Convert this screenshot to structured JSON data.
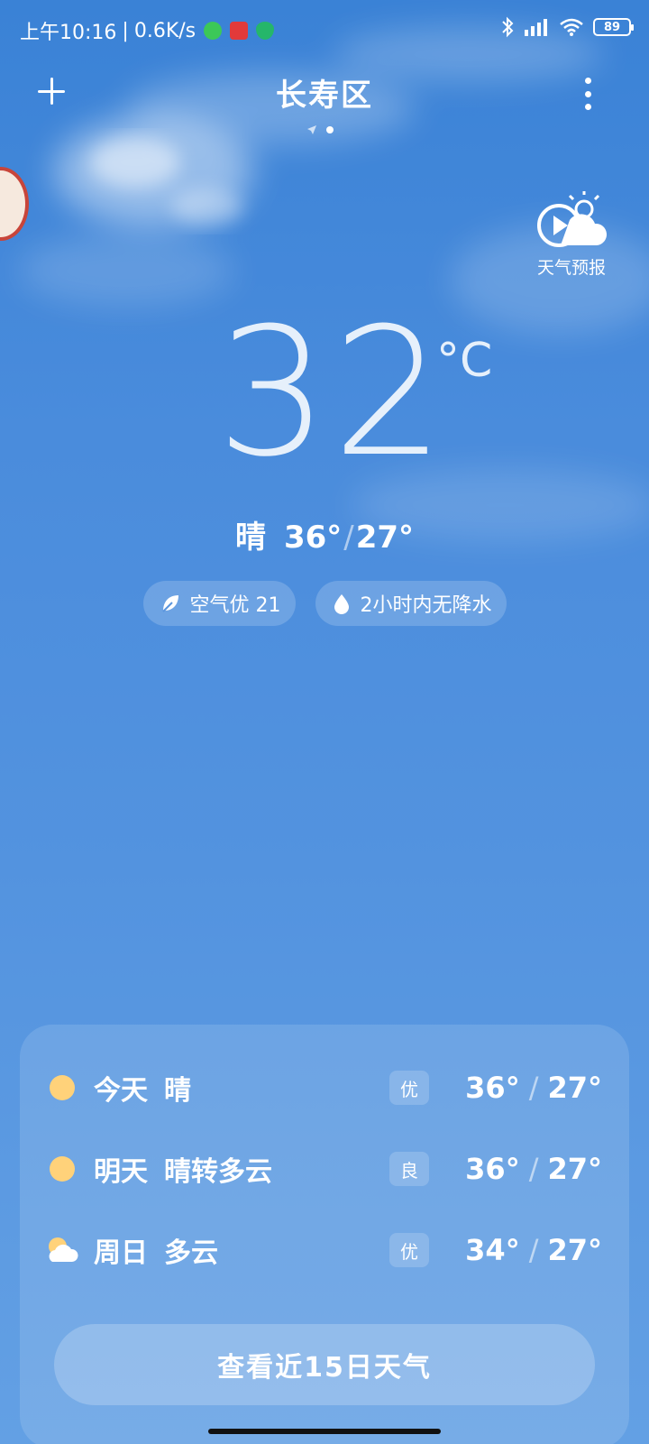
{
  "status_bar": {
    "time": "上午10:16",
    "net_speed": "0.6K/s",
    "battery": "89"
  },
  "header": {
    "city": "长寿区",
    "forecast_video_label": "天气预报"
  },
  "current": {
    "temperature": "32",
    "unit": "°C",
    "condition": "晴",
    "high": "36°",
    "low": "27°"
  },
  "chips": {
    "air_quality": "空气优 21",
    "precipitation": "2小时内无降水"
  },
  "forecast": [
    {
      "day": "今天",
      "weather": "晴",
      "aqi": "优",
      "high": "36°",
      "low": "27°",
      "icon": "sun-icon"
    },
    {
      "day": "明天",
      "weather": "晴转多云",
      "aqi": "良",
      "high": "36°",
      "low": "27°",
      "icon": "sun-icon"
    },
    {
      "day": "周日",
      "weather": "多云",
      "aqi": "优",
      "high": "34°",
      "low": "27°",
      "icon": "partly-cloudy-icon"
    }
  ],
  "more_button": "查看近15日天气",
  "colors": {
    "sun": "#ffd27a",
    "cloud": "#ffffff",
    "sky_top": "#3a82d6",
    "sky_bottom": "#63a0e4"
  }
}
